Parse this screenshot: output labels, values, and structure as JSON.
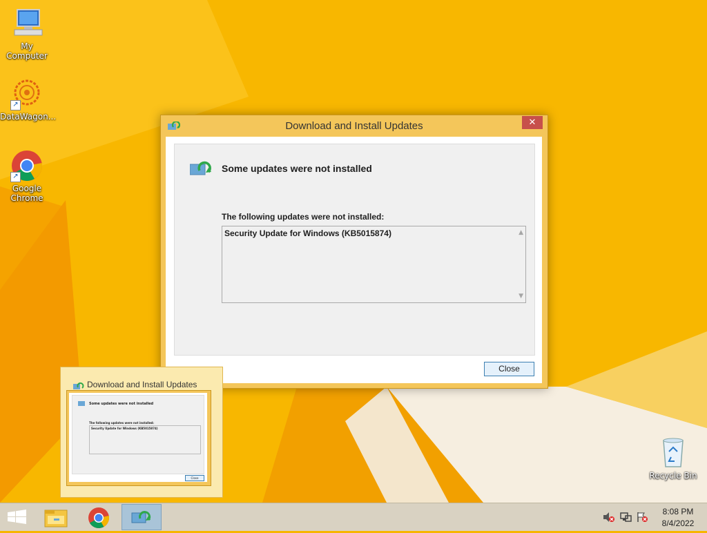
{
  "desktop": {
    "icons": [
      {
        "label": "My Computer",
        "icon": "computer-icon"
      },
      {
        "label": "DataWagon...",
        "icon": "datawagon-icon"
      },
      {
        "label": "Google Chrome",
        "icon": "chrome-icon"
      },
      {
        "label": "Recycle Bin",
        "icon": "recycle-bin-icon"
      }
    ]
  },
  "dialog": {
    "title": "Download and Install Updates",
    "close_glyph": "✕",
    "heading": "Some updates were not installed",
    "subheading": "The following updates were not installed:",
    "failed_updates": [
      "Security Update for Windows (KB5015874)"
    ],
    "close_button": "Close"
  },
  "thumbnail": {
    "title": "Download and Install Updates",
    "heading": "Some updates were not installed",
    "subheading": "The following updates were not installed:",
    "item": "Security Update for Windows (KB5015874)",
    "button": "Close"
  },
  "taskbar": {
    "buttons": [
      "start-icon",
      "file-explorer-icon",
      "chrome-icon",
      "windows-update-icon"
    ],
    "tray": [
      "volume-muted-icon",
      "network-icon",
      "action-center-flag-icon"
    ],
    "time": "8:08 PM",
    "date": "8/4/2022"
  },
  "colors": {
    "wallpaper": "#f7b500",
    "dialog_frame": "#f4c65a",
    "close_red": "#c7504b",
    "button_border": "#3c7fb1"
  }
}
